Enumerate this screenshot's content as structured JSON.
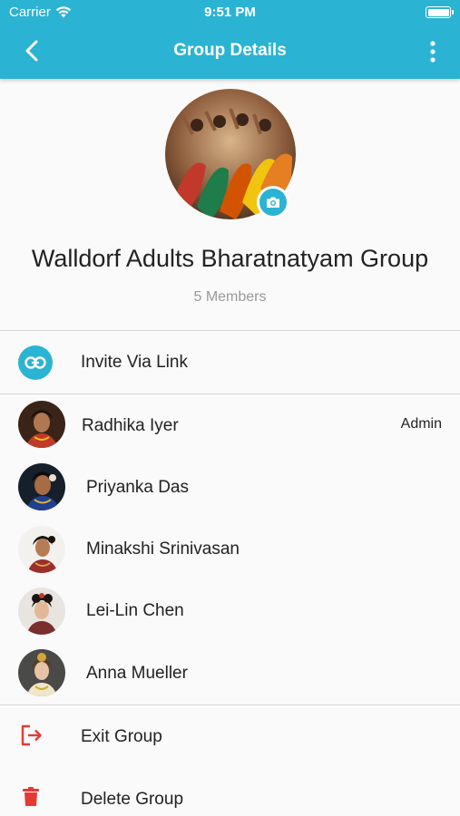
{
  "status_bar": {
    "carrier": "Carrier",
    "time": "9:51 PM"
  },
  "nav": {
    "title": "Group Details",
    "back_icon": "chevron-left-icon",
    "more_icon": "more-vertical-icon"
  },
  "group": {
    "name": "Walldorf Adults Bharatnatyam Group",
    "member_count": "5 Members"
  },
  "invite": {
    "label": "Invite Via Link"
  },
  "members": [
    {
      "name": "Radhika Iyer",
      "role": "Admin"
    },
    {
      "name": "Priyanka Das",
      "role": ""
    },
    {
      "name": "Minakshi Srinivasan",
      "role": ""
    },
    {
      "name": "Lei-Lin Chen",
      "role": ""
    },
    {
      "name": "Anna Mueller",
      "role": ""
    }
  ],
  "actions": {
    "exit_label": "Exit Group",
    "delete_label": "Delete Group"
  },
  "colors": {
    "accent": "#2bb3d3",
    "danger": "#e53935",
    "text": "#222222",
    "muted": "#999999"
  }
}
